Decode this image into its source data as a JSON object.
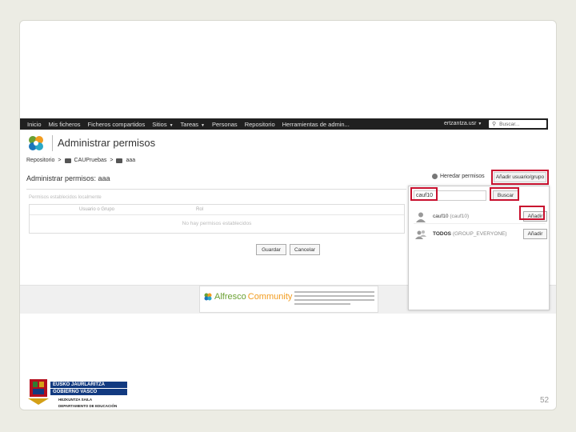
{
  "navbar": {
    "items": [
      "Inicio",
      "Mis ficheros",
      "Ficheros compartidos",
      "Sitios",
      "Tareas",
      "Personas",
      "Repositorio",
      "Herramientas de admin..."
    ],
    "dropdown_items": [
      "Sitios",
      "Tareas"
    ],
    "user": "ertzantza.usr",
    "search_placeholder": "Buscar..."
  },
  "header": {
    "title": "Administrar permisos"
  },
  "breadcrumb": {
    "root": "Repositorio",
    "sep": ">",
    "folder1": "CAUPruebas",
    "folder2": "aaa"
  },
  "section": {
    "title": "Administrar permisos: aaa",
    "inherit_link": "Heredar permisos",
    "add_user_button": "Añadir usuario/grupo"
  },
  "permissions": {
    "label": "Permisos establecidos localmente",
    "col_user": "Usuario o Grupo",
    "col_role": "Rol",
    "empty_message": "No hay permisos establecidos"
  },
  "actions": {
    "save": "Guardar",
    "cancel": "Cancelar"
  },
  "popup": {
    "input_value": "cauf10",
    "search_button": "Buscar",
    "results": [
      {
        "name": "cauf10",
        "id": "(cauf10)",
        "add": "Añadir"
      },
      {
        "name": "TODOS",
        "id": "(GROUP_EVERYONE)",
        "add": "Añadir"
      }
    ]
  },
  "footer": {
    "brand": "Alfresco",
    "brand_word": "Community"
  },
  "gov": {
    "line1": "EUSKO JAURLARITZA",
    "line2": "GOBIERNO VASCO",
    "sub1": "HEZKUNTZA SAILA",
    "sub2": "DEPARTAMENTO DE EDUCACIÓN"
  },
  "page_number": "52",
  "colors": {
    "highlight": "#c8102e",
    "navbar": "#202020",
    "gov_blue": "#123a80"
  }
}
